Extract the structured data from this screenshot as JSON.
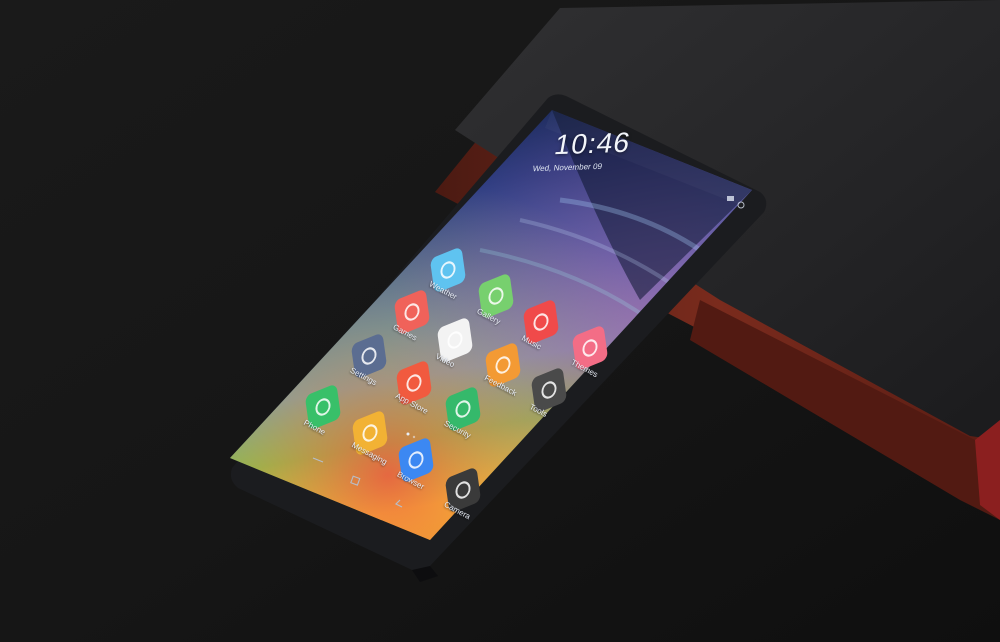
{
  "status_bar": {
    "time": "10:46",
    "date": "Wed, November 09"
  },
  "home_apps": [
    {
      "label": "Weather",
      "icon": "weather-icon",
      "color": "#5fc3f0"
    },
    {
      "label": "Gallery",
      "icon": "gallery-icon",
      "color": "#77d06e"
    },
    {
      "label": "Games",
      "icon": "games-icon",
      "color": "#f0625a"
    },
    {
      "label": "Music",
      "icon": "music-icon",
      "color": "#f04a4a"
    },
    {
      "label": "Video",
      "icon": "video-icon",
      "color": "#f3f3f3"
    },
    {
      "label": "Themes",
      "icon": "themes-icon",
      "color": "#f36d86"
    },
    {
      "label": "Settings",
      "icon": "gear-icon",
      "color": "#5b6d91"
    },
    {
      "label": "Feedback",
      "icon": "feedback-icon",
      "color": "#f39a34"
    },
    {
      "label": "App Store",
      "icon": "mi-store-icon",
      "color": "#f15a3f"
    },
    {
      "label": "Security",
      "icon": "shield-icon",
      "color": "#35b96b"
    },
    {
      "label": "Tools",
      "icon": "tools-icon",
      "color": "#4a4a4a"
    }
  ],
  "dock_apps": [
    {
      "label": "Phone",
      "icon": "phone-icon",
      "color": "#38c069"
    },
    {
      "label": "Messaging",
      "icon": "messaging-icon",
      "color": "#f2b234"
    },
    {
      "label": "Browser",
      "icon": "browser-icon",
      "color": "#3c88f2"
    },
    {
      "label": "Camera",
      "icon": "camera-icon",
      "color": "#3a3a3a"
    }
  ],
  "colors": {
    "background": "#141414",
    "notebook": "#242426",
    "notebook_cover_edge": "#7a2b1d",
    "phone_body": "#1b1c1f",
    "wallpaper_blue": "#233b7f",
    "wallpaper_orange": "#f07a2a",
    "wallpaper_yellow": "#f2c237",
    "wallpaper_green": "#5db15b"
  }
}
